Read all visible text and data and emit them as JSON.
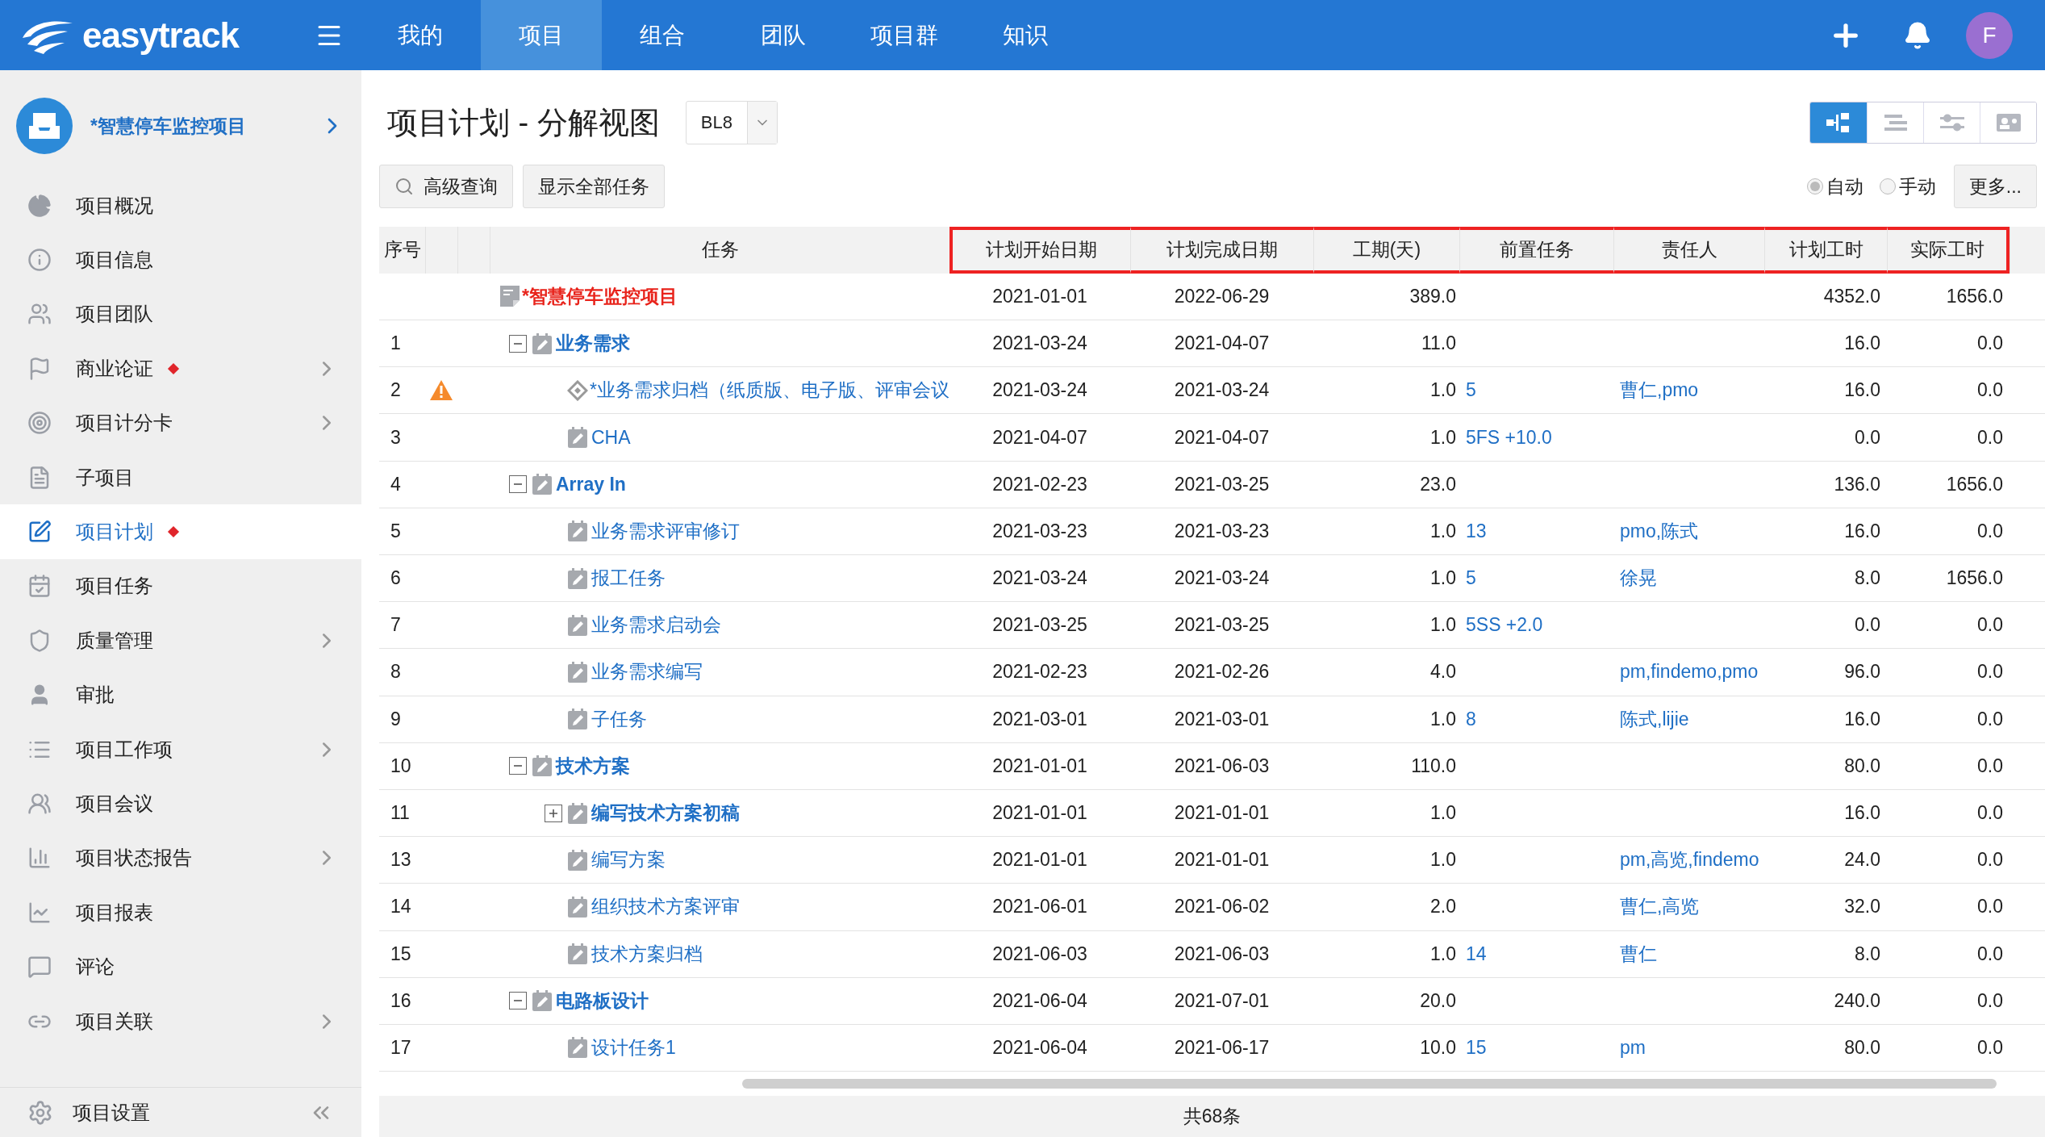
{
  "app": {
    "brand": "easytrack",
    "avatar": "F"
  },
  "nav": [
    {
      "label": "我的",
      "selected": false
    },
    {
      "label": "项目",
      "selected": true
    },
    {
      "label": "组合",
      "selected": false
    },
    {
      "label": "团队",
      "selected": false
    },
    {
      "label": "项目群",
      "selected": false
    },
    {
      "label": "知识",
      "selected": false
    }
  ],
  "sidebar": {
    "project": "*智慧停车监控项目",
    "items": [
      {
        "label": "项目概况",
        "selected": false,
        "flagged": false,
        "submenu": false
      },
      {
        "label": "项目信息",
        "selected": false,
        "flagged": false,
        "submenu": false
      },
      {
        "label": "项目团队",
        "selected": false,
        "flagged": false,
        "submenu": false
      },
      {
        "label": "商业论证",
        "selected": false,
        "flagged": true,
        "submenu": true
      },
      {
        "label": "项目计分卡",
        "selected": false,
        "flagged": false,
        "submenu": true
      },
      {
        "label": "子项目",
        "selected": false,
        "flagged": false,
        "submenu": false
      },
      {
        "label": "项目计划",
        "selected": true,
        "flagged": true,
        "submenu": false
      },
      {
        "label": "项目任务",
        "selected": false,
        "flagged": false,
        "submenu": false
      },
      {
        "label": "质量管理",
        "selected": false,
        "flagged": false,
        "submenu": true
      },
      {
        "label": "审批",
        "selected": false,
        "flagged": false,
        "submenu": false
      },
      {
        "label": "项目工作项",
        "selected": false,
        "flagged": false,
        "submenu": true
      },
      {
        "label": "项目会议",
        "selected": false,
        "flagged": false,
        "submenu": false
      },
      {
        "label": "项目状态报告",
        "selected": false,
        "flagged": false,
        "submenu": true
      },
      {
        "label": "项目报表",
        "selected": false,
        "flagged": false,
        "submenu": false
      },
      {
        "label": "评论",
        "selected": false,
        "flagged": false,
        "submenu": false
      },
      {
        "label": "项目关联",
        "selected": false,
        "flagged": false,
        "submenu": true
      }
    ],
    "footer": "项目设置"
  },
  "page": {
    "title": "项目计划 - 分解视图",
    "baseline": "BL8",
    "buttons": [
      "高级查询",
      "显示全部任务"
    ],
    "views": [
      {
        "selected": true
      },
      {
        "selected": false
      },
      {
        "selected": false
      },
      {
        "selected": false
      }
    ],
    "modes": [
      {
        "label": "自动",
        "selected": true
      },
      {
        "label": "手动",
        "selected": false
      }
    ],
    "more": "更多..."
  },
  "table": {
    "columns": [
      {
        "label": "序号",
        "highlighted": false
      },
      {
        "highlighted": false
      },
      {
        "highlighted": false
      },
      {
        "label": "任务",
        "highlighted": false
      },
      {
        "label": "计划开始日期",
        "highlighted": true
      },
      {
        "label": "计划完成日期",
        "highlighted": true
      },
      {
        "label": "工期(天)",
        "highlighted": true
      },
      {
        "label": "前置任务",
        "highlighted": true
      },
      {
        "label": "责任人",
        "highlighted": true
      },
      {
        "label": "计划工时",
        "highlighted": true
      },
      {
        "label": "实际工时",
        "highlighted": true
      }
    ],
    "rows": [
      {
        "kind": "root",
        "name": "*智慧停车监控项目",
        "start": "2021-01-01",
        "end": "2022-06-29",
        "duration": "389.0",
        "planned": "4352.0",
        "actual": "1656.0",
        "warning": false,
        "children": [
          {
            "kind": "summary",
            "no": "1",
            "name": "业务需求",
            "expanded": true,
            "start": "2021-03-24",
            "end": "2021-04-07",
            "duration": "11.0",
            "planned": "16.0",
            "actual": "0.0",
            "warning": false,
            "children": [
              {
                "kind": "milestone",
                "no": "2",
                "name": "*业务需求归档（纸质版、电子版、评审会议",
                "start": "2021-03-24",
                "end": "2021-03-24",
                "duration": "1.0",
                "predecessor": "5",
                "owner": "曹仁,pmo",
                "planned": "16.0",
                "actual": "0.0",
                "warning": true
              },
              {
                "kind": "task",
                "no": "3",
                "name": "CHA",
                "start": "2021-04-07",
                "end": "2021-04-07",
                "duration": "1.0",
                "predecessor": "5FS +10.0",
                "planned": "0.0",
                "actual": "0.0",
                "warning": false
              }
            ]
          },
          {
            "kind": "summary",
            "no": "4",
            "name": "Array In",
            "expanded": true,
            "start": "2021-02-23",
            "end": "2021-03-25",
            "duration": "23.0",
            "planned": "136.0",
            "actual": "1656.0",
            "warning": false,
            "children": [
              {
                "kind": "task",
                "no": "5",
                "name": "业务需求评审修订",
                "start": "2021-03-23",
                "end": "2021-03-23",
                "duration": "1.0",
                "predecessor": "13",
                "owner": "pmo,陈式",
                "planned": "16.0",
                "actual": "0.0",
                "warning": false
              },
              {
                "kind": "task",
                "no": "6",
                "name": "报工任务",
                "start": "2021-03-24",
                "end": "2021-03-24",
                "duration": "1.0",
                "predecessor": "5",
                "owner": "徐晃",
                "planned": "8.0",
                "actual": "1656.0",
                "warning": false
              },
              {
                "kind": "task",
                "no": "7",
                "name": "业务需求启动会",
                "start": "2021-03-25",
                "end": "2021-03-25",
                "duration": "1.0",
                "predecessor": "5SS +2.0",
                "planned": "0.0",
                "actual": "0.0",
                "warning": false
              },
              {
                "kind": "task",
                "no": "8",
                "name": "业务需求编写",
                "start": "2021-02-23",
                "end": "2021-02-26",
                "duration": "4.0",
                "owner": "pm,findemo,pmo",
                "planned": "96.0",
                "actual": "0.0",
                "warning": false
              },
              {
                "kind": "task",
                "no": "9",
                "name": "子任务",
                "start": "2021-03-01",
                "end": "2021-03-01",
                "duration": "1.0",
                "predecessor": "8",
                "owner": "陈式,lijie",
                "planned": "16.0",
                "actual": "0.0",
                "warning": false
              }
            ]
          },
          {
            "kind": "summary",
            "no": "10",
            "name": "技术方案",
            "expanded": true,
            "start": "2021-01-01",
            "end": "2021-06-03",
            "duration": "110.0",
            "planned": "80.0",
            "actual": "0.0",
            "warning": false,
            "children": [
              {
                "kind": "summary",
                "no": "11",
                "name": "编写技术方案初稿",
                "expanded": false,
                "start": "2021-01-01",
                "end": "2021-01-01",
                "duration": "1.0",
                "planned": "16.0",
                "actual": "0.0",
                "warning": false
              },
              {
                "kind": "task",
                "no": "13",
                "name": "编写方案",
                "start": "2021-01-01",
                "end": "2021-01-01",
                "duration": "1.0",
                "owner": "pm,高览,findemo",
                "planned": "24.0",
                "actual": "0.0",
                "warning": false
              },
              {
                "kind": "task",
                "no": "14",
                "name": "组织技术方案评审",
                "start": "2021-06-01",
                "end": "2021-06-02",
                "duration": "2.0",
                "owner": "曹仁,高览",
                "planned": "32.0",
                "actual": "0.0",
                "warning": false
              },
              {
                "kind": "task",
                "no": "15",
                "name": "技术方案归档",
                "start": "2021-06-03",
                "end": "2021-06-03",
                "duration": "1.0",
                "predecessor": "14",
                "owner": "曹仁",
                "planned": "8.0",
                "actual": "0.0",
                "warning": false
              }
            ]
          },
          {
            "kind": "summary",
            "no": "16",
            "name": "电路板设计",
            "expanded": true,
            "start": "2021-06-04",
            "end": "2021-07-01",
            "duration": "20.0",
            "planned": "240.0",
            "actual": "0.0",
            "warning": false,
            "children": [
              {
                "kind": "task",
                "no": "17",
                "name": "设计任务1",
                "start": "2021-06-04",
                "end": "2021-06-17",
                "duration": "10.0",
                "predecessor": "15",
                "owner": "pm",
                "planned": "80.0",
                "actual": "0.0",
                "warning": false
              }
            ]
          }
        ]
      }
    ],
    "total": "共68条"
  }
}
